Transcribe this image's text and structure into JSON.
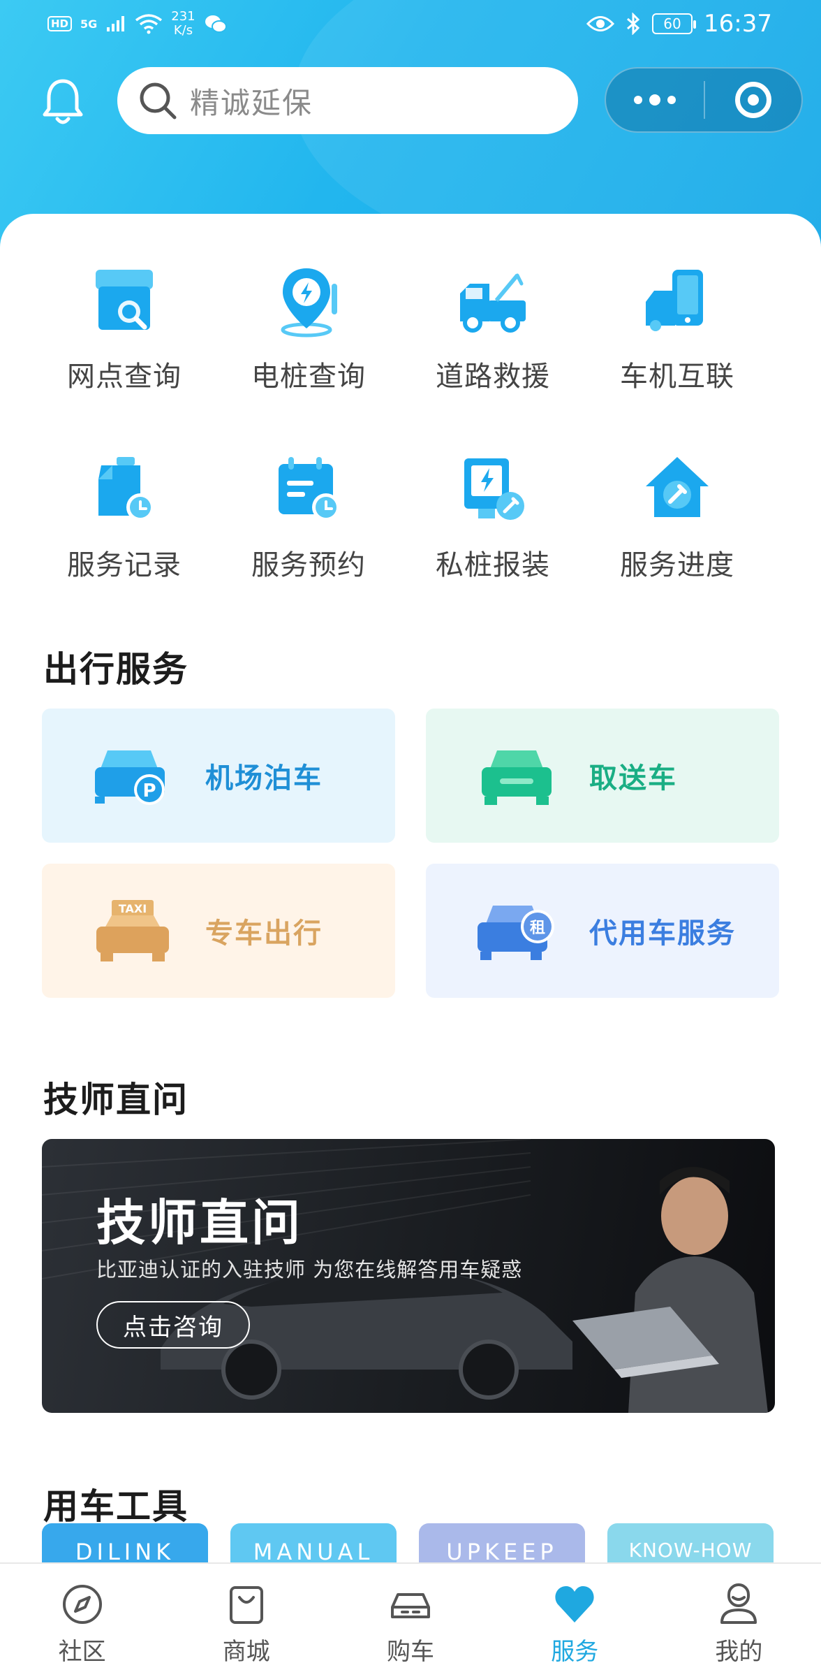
{
  "status_bar": {
    "hd": "HD",
    "network": "5G",
    "speed_value": "231",
    "speed_unit": "K/s",
    "battery": "60",
    "time": "16:37"
  },
  "header": {
    "search_placeholder": "精诚延保"
  },
  "quick_actions": [
    {
      "label": "网点查询",
      "icon": "store-search-icon"
    },
    {
      "label": "电桩查询",
      "icon": "charging-pin-icon"
    },
    {
      "label": "道路救援",
      "icon": "tow-truck-icon"
    },
    {
      "label": "车机互联",
      "icon": "car-phone-icon"
    },
    {
      "label": "服务记录",
      "icon": "service-record-icon"
    },
    {
      "label": "服务预约",
      "icon": "calendar-clock-icon"
    },
    {
      "label": "私桩报装",
      "icon": "private-charger-icon"
    },
    {
      "label": "服务进度",
      "icon": "house-wrench-icon"
    }
  ],
  "travel_section": {
    "title": "出行服务",
    "items": [
      {
        "label": "机场泊车",
        "icon": "airport-parking-icon",
        "color": "#1f8fd6",
        "bg": "#e6f5fd"
      },
      {
        "label": "取送车",
        "icon": "car-pickup-icon",
        "color": "#1aae84",
        "bg": "#e7f8f2"
      },
      {
        "label": "专车出行",
        "icon": "taxi-icon",
        "color": "#d9a460",
        "bg": "#fff4e8"
      },
      {
        "label": "代用车服务",
        "icon": "rental-car-icon",
        "color": "#3b7ee0",
        "bg": "#edf3fe"
      }
    ]
  },
  "tech_section": {
    "title": "技师直问",
    "banner_title": "技师直问",
    "banner_subtitle": "比亚迪认证的入驻技师  为您在线解答用车疑惑",
    "banner_button": "点击咨询"
  },
  "tools_section": {
    "title": "用车工具",
    "items": [
      {
        "label": "DILINK",
        "color": "#37a8ec"
      },
      {
        "label": "MANUAL",
        "color": "#5fc8f2"
      },
      {
        "label": "UPKEEP",
        "color": "#aab9ea"
      },
      {
        "label": "KNOW-HOW",
        "color": "#8ad8ec"
      }
    ]
  },
  "tabbar": [
    {
      "label": "社区",
      "icon": "compass-icon",
      "active": false
    },
    {
      "label": "商城",
      "icon": "shopping-bag-icon",
      "active": false
    },
    {
      "label": "购车",
      "icon": "car-icon",
      "active": false
    },
    {
      "label": "服务",
      "icon": "heart-icon",
      "active": true
    },
    {
      "label": "我的",
      "icon": "profile-icon",
      "active": false
    }
  ]
}
